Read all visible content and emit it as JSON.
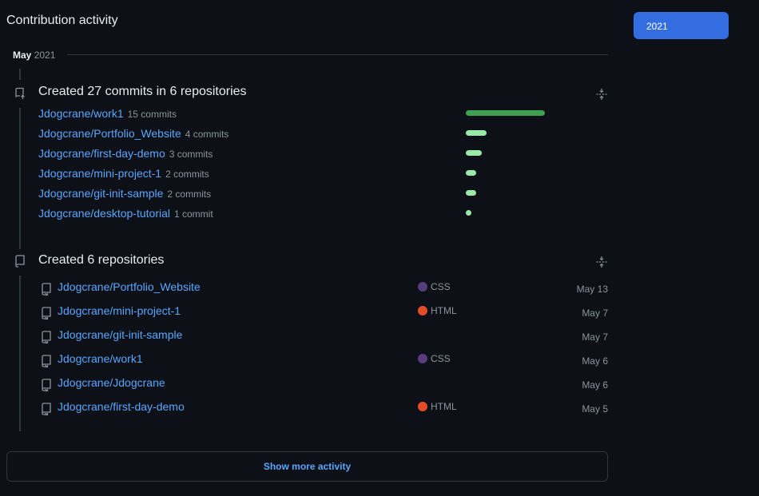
{
  "header": {
    "title": "Contribution activity"
  },
  "year_filter": {
    "selected": "2021"
  },
  "month": {
    "name": "May",
    "year": "2021"
  },
  "commits_section": {
    "title": "Created 27 commits in 6 repositories",
    "max_commits": 15,
    "items": [
      {
        "repo": "Jdogcrane/work1",
        "count_text": "15 commits",
        "commits": 15,
        "bar_color": "#3fa14f"
      },
      {
        "repo": "Jdogcrane/Portfolio_Website",
        "count_text": "4 commits",
        "commits": 4,
        "bar_color": "#9be9a8"
      },
      {
        "repo": "Jdogcrane/first-day-demo",
        "count_text": "3 commits",
        "commits": 3,
        "bar_color": "#9be9a8"
      },
      {
        "repo": "Jdogcrane/mini-project-1",
        "count_text": "2 commits",
        "commits": 2,
        "bar_color": "#9be9a8"
      },
      {
        "repo": "Jdogcrane/git-init-sample",
        "count_text": "2 commits",
        "commits": 2,
        "bar_color": "#9be9a8"
      },
      {
        "repo": "Jdogcrane/desktop-tutorial",
        "count_text": "1 commit",
        "commits": 1,
        "bar_color": "#9be9a8"
      }
    ]
  },
  "repos_section": {
    "title": "Created 6 repositories",
    "items": [
      {
        "repo": "Jdogcrane/Portfolio_Website",
        "language": "CSS",
        "lang_color": "#563d7c",
        "date": "May 13"
      },
      {
        "repo": "Jdogcrane/mini-project-1",
        "language": "HTML",
        "lang_color": "#e34c26",
        "date": "May 7"
      },
      {
        "repo": "Jdogcrane/git-init-sample",
        "language": "",
        "lang_color": "",
        "date": "May 7"
      },
      {
        "repo": "Jdogcrane/work1",
        "language": "CSS",
        "lang_color": "#563d7c",
        "date": "May 6"
      },
      {
        "repo": "Jdogcrane/Jdogcrane",
        "language": "",
        "lang_color": "",
        "date": "May 6"
      },
      {
        "repo": "Jdogcrane/first-day-demo",
        "language": "HTML",
        "lang_color": "#e34c26",
        "date": "May 5"
      }
    ]
  },
  "footer": {
    "show_more_label": "Show more activity"
  }
}
